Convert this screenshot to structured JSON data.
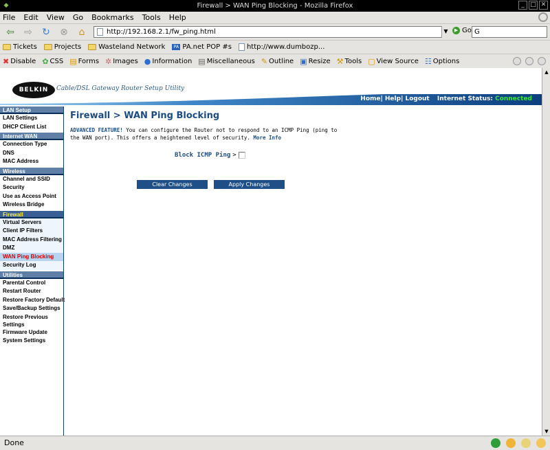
{
  "window": {
    "title": "Firewall > WAN Ping Blocking - Mozilla Firefox"
  },
  "menu": [
    "File",
    "Edit",
    "View",
    "Go",
    "Bookmarks",
    "Tools",
    "Help"
  ],
  "nav": {
    "url": "http://192.168.2.1/fw_ping.html",
    "go_label": "Go",
    "search_value": "G"
  },
  "bookmarks": [
    "Tickets",
    "Projects",
    "Wasteland Network",
    "PA.net POP #s",
    "http://www.dumbozp..."
  ],
  "devbar": [
    "Disable",
    "CSS",
    "Forms",
    "Images",
    "Information",
    "Miscellaneous",
    "Outline",
    "Resize",
    "Tools",
    "View Source",
    "Options"
  ],
  "header": {
    "logo": "BELKIN",
    "tagline": "Cable/DSL Gateway Router Setup Utility",
    "links": "Home| Help| Logout",
    "status_label": "Internet Status:",
    "status_value": "Connected",
    "status_color": "#39e639"
  },
  "sidebar": {
    "sections": [
      {
        "title": "LAN Setup",
        "items": [
          "LAN Settings",
          "DHCP Client List"
        ]
      },
      {
        "title": "Internet WAN",
        "items": [
          "Connection Type",
          "DNS",
          "MAC Address"
        ]
      },
      {
        "title": "Wireless",
        "items": [
          "Channel and SSID",
          "Security",
          "Use as Access Point",
          "Wireless Bridge"
        ]
      },
      {
        "title": "Firewall",
        "items": [
          "Virtual Servers",
          "Client IP Filters",
          "MAC Address Filtering",
          "DMZ",
          "WAN Ping Blocking",
          "Security Log"
        ]
      },
      {
        "title": "Utilities",
        "items": [
          "Parental Control",
          "Restart Router",
          "Restore Factory Default",
          "Save/Backup Settings",
          "Restore Previous Settings",
          "Firmware Update",
          "System Settings"
        ]
      }
    ],
    "active_item": "WAN Ping Blocking"
  },
  "main": {
    "title": "Firewall > WAN Ping Blocking",
    "desc_bold": "ADVANCED FEATURE!",
    "desc_text": " You can configure the Router not to respond to an ICMP Ping (ping to the WAN port). This offers a heightened level of security. ",
    "more_info": "More Info",
    "block_label": "Block ICMP Ping",
    "block_sep": ">",
    "block_checked": false,
    "clear_button": "Clear Changes",
    "apply_button": "Apply Changes"
  },
  "status": {
    "text": "Done"
  }
}
